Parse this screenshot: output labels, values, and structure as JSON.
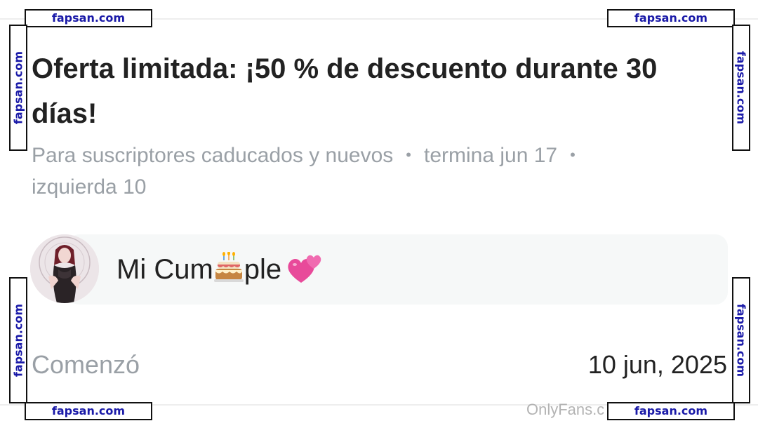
{
  "offer": {
    "headline": "Oferta limitada: ¡50 % de descuento durante 30 días!",
    "audience": "Para suscriptores caducados y nuevos",
    "ends": "termina jun 17",
    "remaining": "izquierda 10"
  },
  "message": {
    "text_before": "Mi Cum",
    "cake_icon": "birthday-cake-emoji",
    "text_after": "ple",
    "hearts_icon": "two-hearts-emoji"
  },
  "started": {
    "label": "Comenzó",
    "date": "10 jun, 2025"
  },
  "footer": {
    "brand": "OnlyFans.c"
  },
  "watermark": {
    "text": "fapsan.com",
    "color": "#1a1aa8"
  }
}
